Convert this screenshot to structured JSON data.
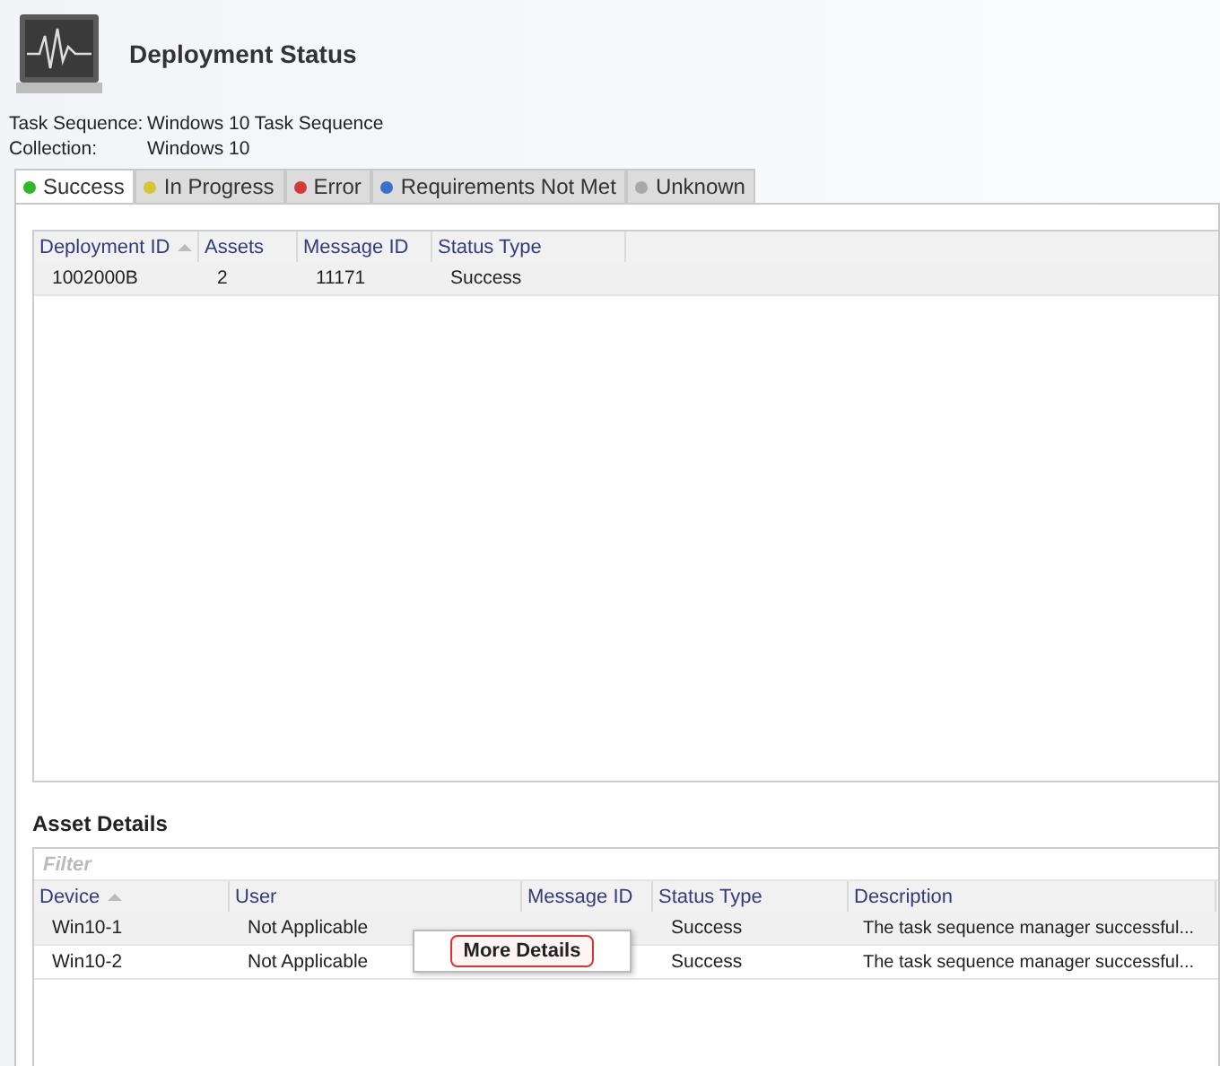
{
  "window": {
    "title": "Deployment Status"
  },
  "info": [
    {
      "label": "Task Sequence:",
      "value": "Windows 10 Task Sequence"
    },
    {
      "label": "Collection:",
      "value": "Windows 10"
    }
  ],
  "tabs": [
    {
      "label": "Success",
      "color": "#2db82d",
      "selected": true
    },
    {
      "label": "In Progress",
      "color": "#d8c437",
      "selected": false
    },
    {
      "label": "Error",
      "color": "#d33b3b",
      "selected": false
    },
    {
      "label": "Requirements Not Met",
      "color": "#3b6fc9",
      "selected": false
    },
    {
      "label": "Unknown",
      "color": "#a8a8a8",
      "selected": false
    }
  ],
  "deployments": {
    "columns": [
      {
        "label": "Deployment ID",
        "sorted": true
      },
      {
        "label": "Assets",
        "sorted": false
      },
      {
        "label": "Message ID",
        "sorted": false
      },
      {
        "label": "Status Type",
        "sorted": false
      }
    ],
    "rows": [
      {
        "cells": [
          "1002000B",
          "2",
          "11171",
          "Success"
        ],
        "selected": true
      }
    ]
  },
  "asset_details": {
    "title": "Asset Details",
    "filter": {
      "placeholder": "Filter"
    },
    "columns": [
      {
        "label": "Device",
        "sorted": true
      },
      {
        "label": "User",
        "sorted": false
      },
      {
        "label": "Message ID",
        "sorted": false
      },
      {
        "label": "Status Type",
        "sorted": false
      },
      {
        "label": "Description",
        "sorted": false
      }
    ],
    "rows": [
      {
        "cells": [
          "Win10-1",
          "Not Applicable",
          "",
          "Success",
          "The task sequence manager successful..."
        ],
        "selected": true
      },
      {
        "cells": [
          "Win10-2",
          "Not Applicable",
          "",
          "Success",
          "The task sequence manager successful..."
        ],
        "selected": false
      }
    ]
  },
  "context_menu": {
    "items": [
      {
        "label": "More Details",
        "highlighted": true
      }
    ]
  }
}
